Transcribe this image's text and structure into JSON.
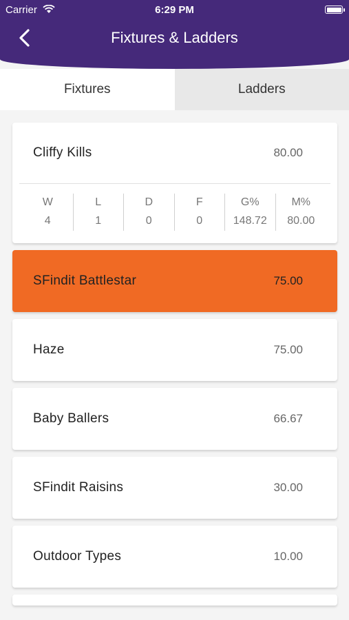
{
  "status_bar": {
    "carrier": "Carrier",
    "time": "6:29 PM"
  },
  "header": {
    "title": "Fixtures & Ladders"
  },
  "tabs": [
    {
      "label": "Fixtures",
      "active": true
    },
    {
      "label": "Ladders",
      "active": false
    }
  ],
  "ladder": [
    {
      "name": "Cliffy Kills",
      "score": "80.00",
      "stats_labels": [
        "W",
        "L",
        "D",
        "F",
        "G%",
        "M%"
      ],
      "stats_values": [
        "4",
        "1",
        "0",
        "0",
        "148.72",
        "80.00"
      ]
    },
    {
      "name": "SFindit Battlestar",
      "score": "75.00",
      "highlight_color": "#f06a24"
    },
    {
      "name": "Haze",
      "score": "75.00"
    },
    {
      "name": "Baby Ballers",
      "score": "66.67"
    },
    {
      "name": "SFindit Raisins",
      "score": "30.00"
    },
    {
      "name": "Outdoor Types",
      "score": "10.00"
    }
  ],
  "colors": {
    "header": "#45297a",
    "highlight": "#f06a24"
  }
}
